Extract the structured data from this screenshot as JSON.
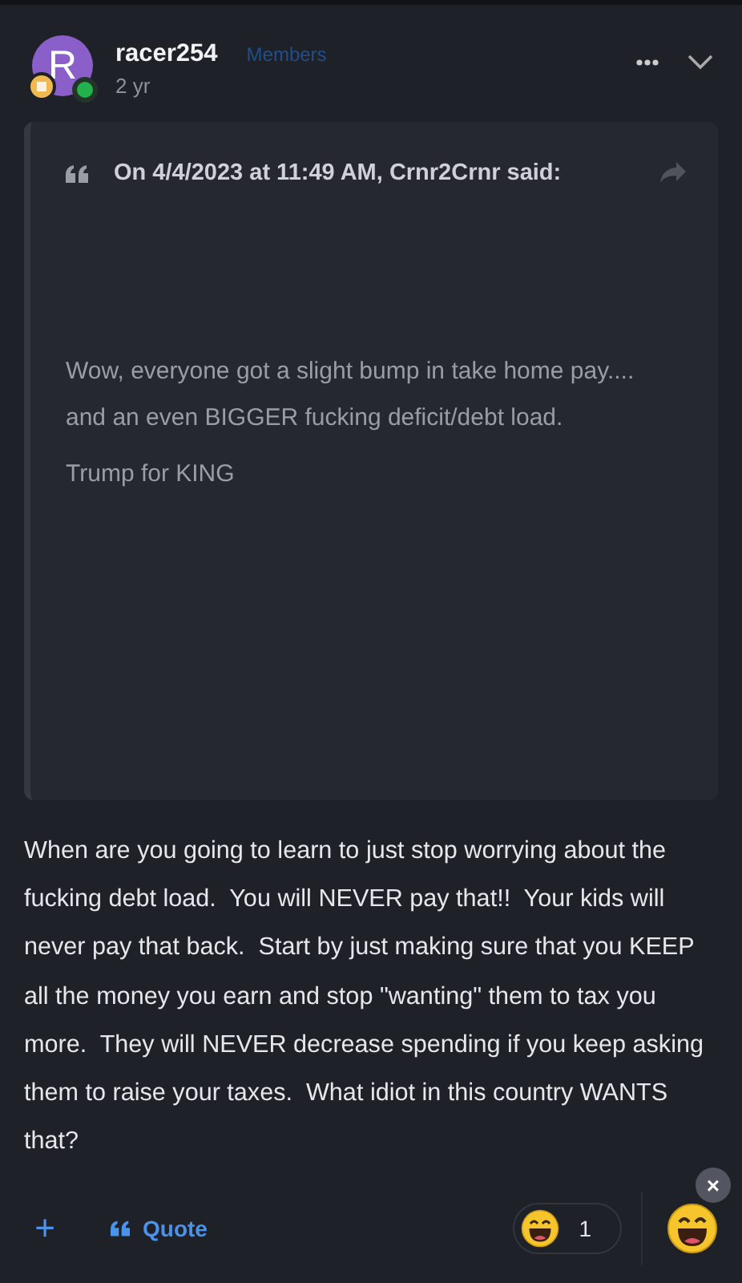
{
  "post": {
    "author": {
      "initial": "R",
      "name": "racer254",
      "group": "Members",
      "online": true
    },
    "time": "2 yr"
  },
  "quote": {
    "header": "On 4/4/2023 at 11:49 AM, Crnr2Crnr said:",
    "paragraphs": [
      {
        "lines": [
          "Wow, everyone got a slight bump in take home pay....",
          "and an even BIGGER fucking deficit/debt load."
        ]
      },
      {
        "lines": [
          "Trump for KING"
        ]
      }
    ]
  },
  "body": "When are you going to learn to just stop worrying about the fucking debt load.  You will NEVER pay that!!  Your kids will never pay that back.  Start by just making sure that you KEEP all the money you earn and stop \"wanting\" them to tax you more.  They will NEVER decrease spending if you keep asking them to raise your taxes.  What idiot in this country WANTS that?",
  "footer": {
    "add": "+",
    "quote_label": "Quote",
    "reaction_count": "1",
    "remove": "×"
  }
}
